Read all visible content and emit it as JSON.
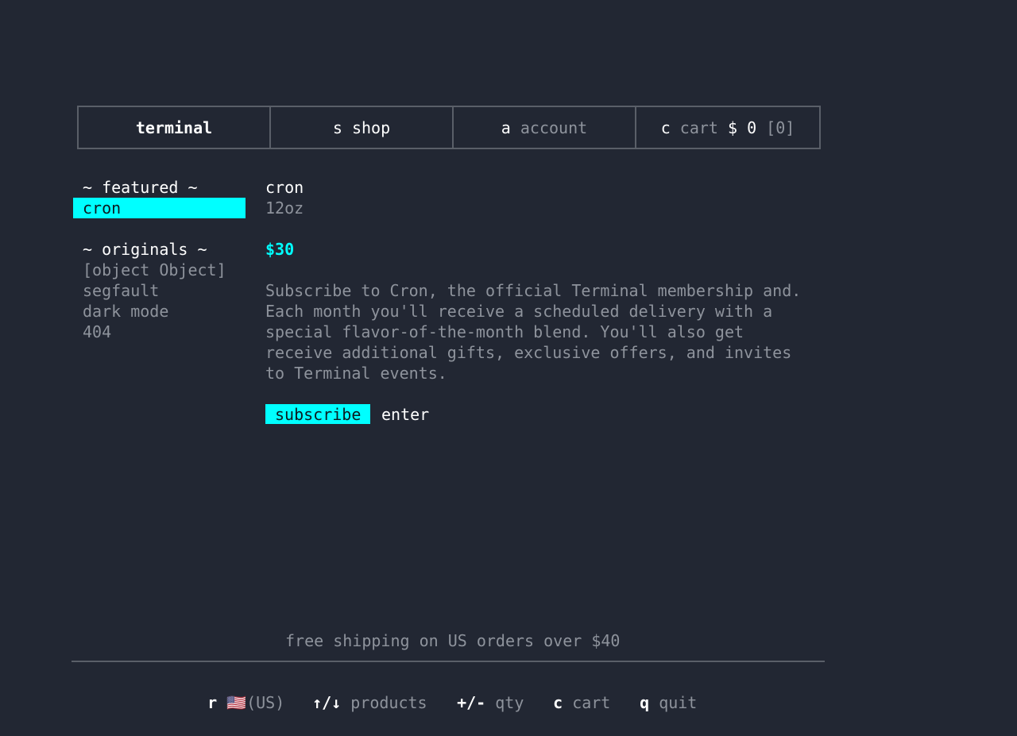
{
  "header": {
    "tabs": [
      {
        "key": "",
        "label": "terminal"
      },
      {
        "key": "s",
        "label": "shop"
      },
      {
        "key": "a",
        "label": "account"
      },
      {
        "key": "c",
        "label": "cart"
      }
    ],
    "cart_total": "$ 0",
    "cart_count": "[0]"
  },
  "sidebar": {
    "featured_heading": "~ featured ~",
    "featured_items": [
      "cron"
    ],
    "originals_heading": "~ originals ~",
    "originals_items": [
      "[object Object]",
      "segfault",
      "dark mode",
      "404"
    ]
  },
  "product": {
    "name": "cron",
    "size": "12oz",
    "price": "$30",
    "description": "Subscribe to Cron, the official Terminal membership and. Each month you'll receive a scheduled delivery with a special flavor-of-the-month blend. You'll also get receive additional gifts, exclusive offers, and invites to Terminal events.",
    "action_label": "subscribe",
    "action_hint": "enter"
  },
  "footer": {
    "shipping_note": "free shipping on US orders over $40",
    "shortcuts": [
      {
        "key": "r",
        "label": "🇺🇸(US)"
      },
      {
        "key": "↑/↓",
        "label": "products"
      },
      {
        "key": "+/-",
        "label": "qty"
      },
      {
        "key": "c",
        "label": "cart"
      },
      {
        "key": "q",
        "label": "quit"
      }
    ]
  },
  "colors": {
    "background": "#222733",
    "accent": "#00ffff",
    "text": "#ffffff",
    "muted": "#8e939c",
    "border": "#5a5f68"
  }
}
